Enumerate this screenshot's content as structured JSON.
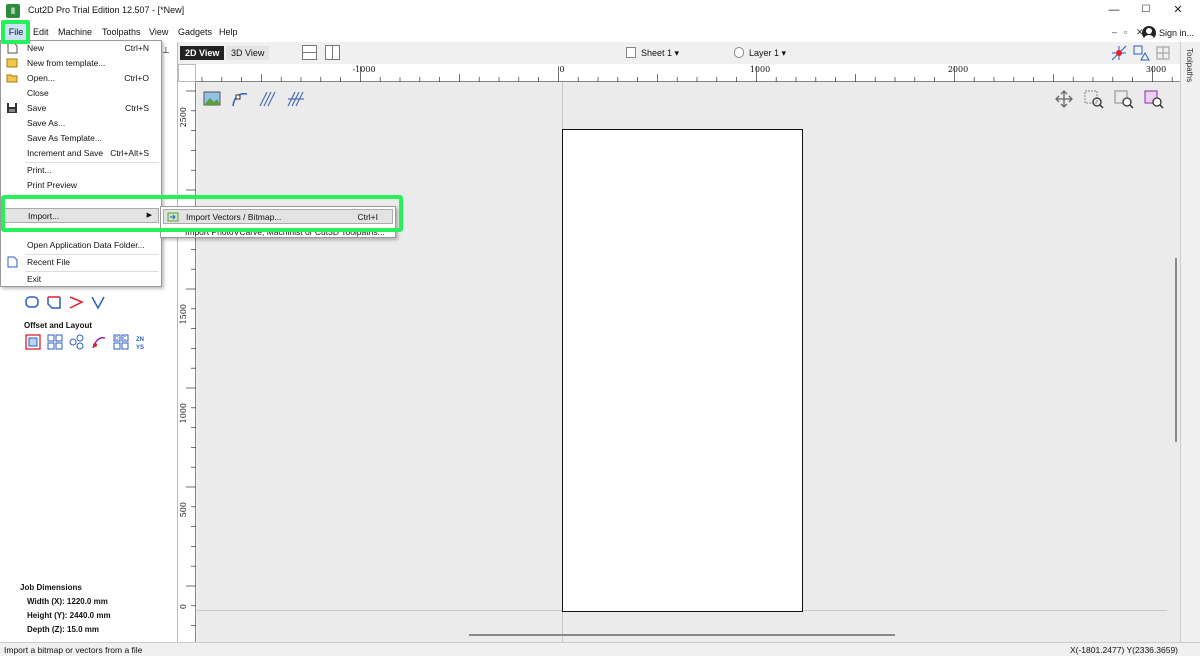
{
  "window": {
    "app_icon": "cut2d-icon",
    "title": "Cut2D Pro Trial Edition 12.507 - [*New]",
    "minimize": "—",
    "maximize": "☐",
    "close": "✕"
  },
  "menu": {
    "items": [
      "File",
      "Edit",
      "Machine",
      "Toolpaths",
      "View",
      "Gadgets",
      "Help"
    ],
    "mdi_controls": [
      "–",
      "▫",
      "✕"
    ],
    "signin": "Sign in..."
  },
  "view_toolbar": {
    "tab_2d": "2D View",
    "tab_3d": "3D View",
    "sheet": "Sheet 1 ▾",
    "layer": "Layer 1 ▾"
  },
  "side_tab": "Toolpaths",
  "file_menu": {
    "items": [
      {
        "label": "New",
        "shortcut": "Ctrl+N",
        "icon": "new-file-icon"
      },
      {
        "label": "New from template...",
        "shortcut": "",
        "icon": ""
      },
      {
        "label": "Open...",
        "shortcut": "Ctrl+O",
        "icon": "folder-open-icon"
      },
      {
        "label": "Close",
        "shortcut": "",
        "icon": ""
      },
      {
        "label": "Save",
        "shortcut": "Ctrl+S",
        "icon": "save-icon"
      },
      {
        "label": "Save As...",
        "shortcut": "",
        "icon": ""
      },
      {
        "label": "Save As Template...",
        "shortcut": "",
        "icon": ""
      },
      {
        "label": "Increment and Save",
        "shortcut": "Ctrl+Alt+S",
        "icon": ""
      },
      {
        "label": "Print...",
        "shortcut": "",
        "icon": ""
      },
      {
        "label": "Print Preview",
        "shortcut": "",
        "icon": ""
      },
      {
        "label": "Import...",
        "shortcut": "",
        "icon": ""
      },
      {
        "label": "Open Application Data Folder...",
        "shortcut": "",
        "icon": ""
      },
      {
        "label": "Recent File",
        "shortcut": "",
        "icon": "recent-file-icon"
      },
      {
        "label": "Exit",
        "shortcut": "",
        "icon": ""
      }
    ],
    "submenu_arrow": "▶"
  },
  "import_submenu": {
    "items": [
      {
        "label": "Import Vectors / Bitmap...",
        "shortcut": "Ctrl+I"
      },
      {
        "label": "Import PhotoVCarve, Machinist or Cut3D Toolpaths...",
        "shortcut": ""
      }
    ]
  },
  "left_panel": {
    "pin": "📌",
    "offset_heading": "Offset and Layout",
    "job_heading": "Job Dimensions",
    "job_width": "Width  (X): 1220.0 mm",
    "job_height": "Height (Y): 2440.0 mm",
    "job_depth": "Depth  (Z): 15.0 mm"
  },
  "ruler": {
    "top_labels": [
      "-1000",
      "0",
      "1000",
      "2000",
      "3000"
    ],
    "left_labels": [
      "2500",
      "1500",
      "1000",
      "500",
      "0"
    ]
  },
  "status": {
    "message": "Import a bitmap or vectors from a file",
    "coords": "X(-1801.2477) Y(2336.3659)"
  },
  "colors": {
    "highlight": "#27f05a",
    "menu_hover": "#cde4f7",
    "tab_active": "#222222"
  }
}
